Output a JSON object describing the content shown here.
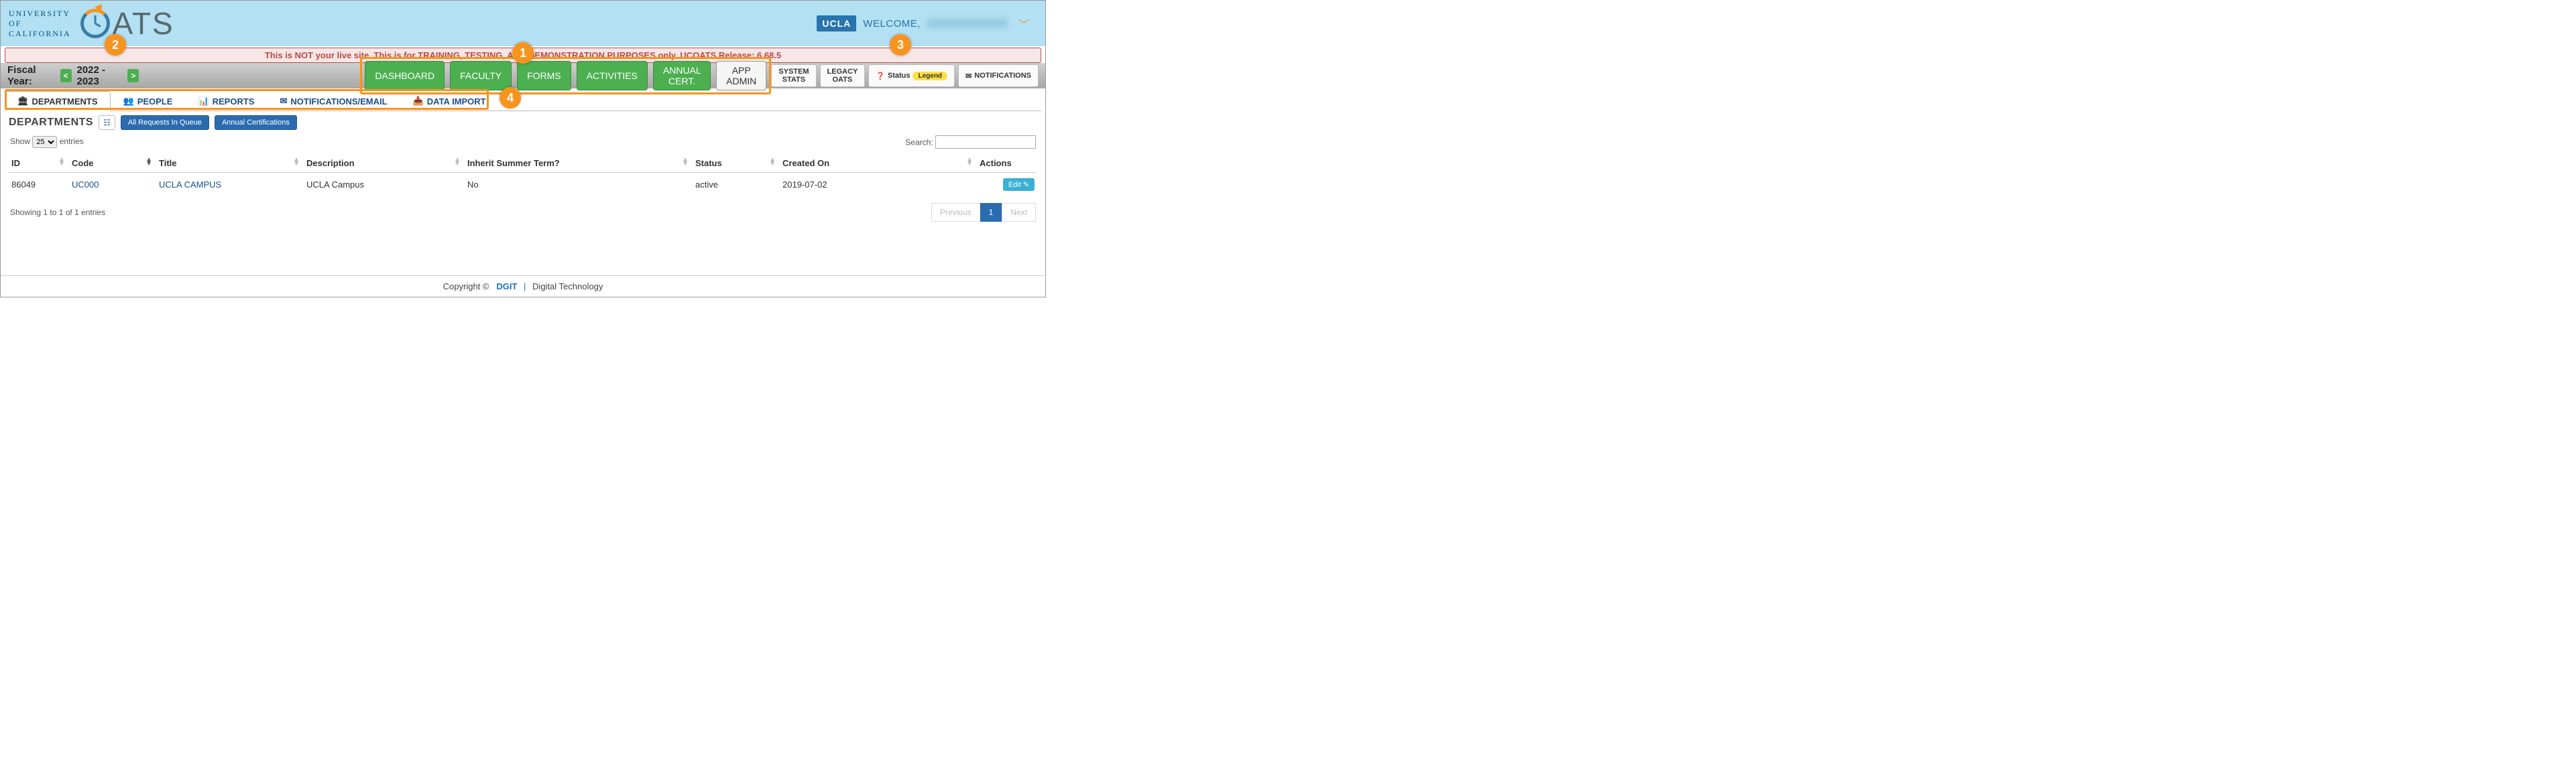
{
  "header": {
    "uc_line1": "UNIVERSITY",
    "uc_line2": "OF",
    "uc_line3": "CALIFORNIA",
    "oats_text": "ATS",
    "campus_badge": "UCLA",
    "welcome_prefix": "WELCOME,"
  },
  "alert": {
    "text": "This is NOT your live site. This is for TRAINING, TESTING, AND DEMONSTRATION PURPOSES only. UCOATS Release: 6.68.5"
  },
  "fiscal_year": {
    "label": "Fiscal Year:",
    "prev": "<",
    "value": "2022 - 2023",
    "next": ">"
  },
  "main_nav": {
    "dashboard": "DASHBOARD",
    "faculty": "FACULTY",
    "forms": "FORMS",
    "activities": "ACTIVITIES",
    "annual_cert": "ANNUAL CERT.",
    "app_admin": "APP ADMIN"
  },
  "right_nav": {
    "system_stats": "SYSTEM STATS",
    "legacy_oats": "LEGACY OATS",
    "status_label": "Status",
    "legend_pill": "Legend",
    "notifications": "NOTIFICATIONS"
  },
  "subtabs": {
    "departments": "DEPARTMENTS",
    "people": "PEOPLE",
    "reports": "REPORTS",
    "notifications_email": "NOTIFICATIONS/EMAIL",
    "data_import": "DATA IMPORT"
  },
  "dept_section": {
    "title": "DEPARTMENTS",
    "all_requests_btn": "All Requests In Queue",
    "annual_cert_btn": "Annual Certifications"
  },
  "datatable": {
    "show_prefix": "Show",
    "show_value": "25",
    "show_suffix": "entries",
    "search_label": "Search:",
    "columns": {
      "id": "ID",
      "code": "Code",
      "title": "Title",
      "description": "Description",
      "inherit": "Inherit Summer Term?",
      "status": "Status",
      "created": "Created On",
      "actions": "Actions"
    },
    "rows": [
      {
        "id": "86049",
        "code": "UC000",
        "title": "UCLA CAMPUS",
        "description": "UCLA Campus",
        "inherit": "No",
        "status": "active",
        "created": "2019-07-02",
        "edit_label": "Edit"
      }
    ],
    "info_text": "Showing 1 to 1 of 1 entries",
    "pager": {
      "prev": "Previous",
      "page1": "1",
      "next": "Next"
    }
  },
  "footer": {
    "copyright": "Copyright ©",
    "dgit": "DGIT",
    "digital_tech": "Digital Technology"
  },
  "annotations": {
    "a1": "1",
    "a2": "2",
    "a3": "3",
    "a4": "4"
  }
}
